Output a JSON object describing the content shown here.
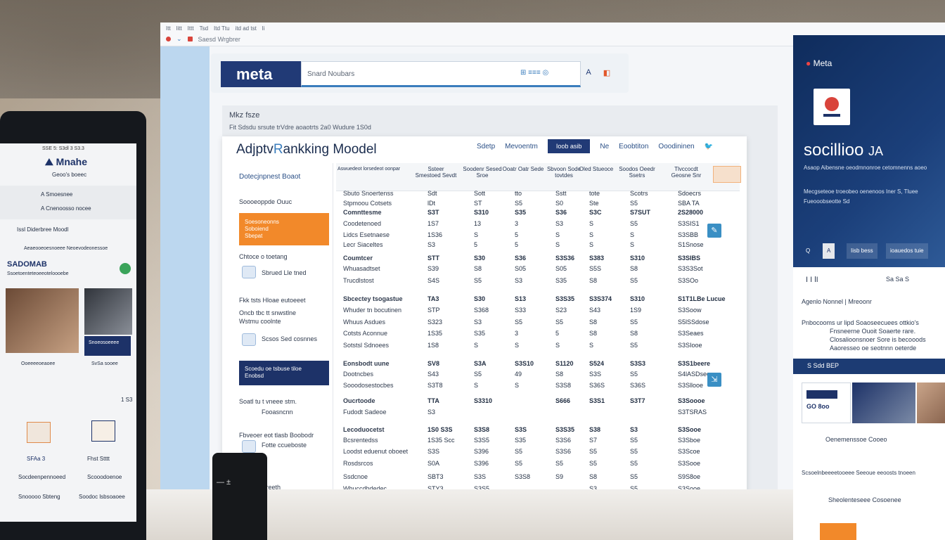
{
  "browser": {
    "tabs": [
      "Itt",
      "litt",
      "Ittt",
      "Tsd",
      "Itd Ttu",
      "itd ad tst",
      "li"
    ],
    "url": "Saesd Wrgbrer"
  },
  "header": {
    "logo": "meta",
    "search_placeholder": "Snard Noubars",
    "search_icons": "⊞ ≡≡≡ ◎",
    "btn_a": "A",
    "btn_b": "◧"
  },
  "page": {
    "crumb": "Mkz fsze",
    "subline": "Fit Sdsdu srsute trVdre aoaotrts 2a0 Wudure 1S0d"
  },
  "card": {
    "title_main": "Adjptv",
    "title_accent": "R",
    "title_rest": "ankking Moodel",
    "nav": [
      "Sdetp",
      "Mevoentm",
      "Ioob asib",
      "Ne",
      "Eoobtiton",
      "Ooodininen"
    ],
    "nav_active_index": 2
  },
  "side": {
    "heading": "Dotecjnpnest Boaot",
    "item1": "Soooeoppde Ouuc",
    "orange": [
      "Soesoneonns",
      "Soboiend",
      "Sbepat"
    ],
    "item2": "Chtoce o toetang",
    "item3": "Sbrued Lle tned",
    "item4": "Fkk tsts Hloae eutoeeet",
    "item5": "Oncb tbc tt snwstlne",
    "item6": "Wstmu coolnte",
    "item7": "Scsos Sed cosnnes",
    "navy": [
      "Scoedu oe tsbuse tiloe",
      "Enobsd"
    ],
    "item8": "Soatl tu t vneee stm.",
    "item9": "Fooasncnn",
    "item10": "Fbveoer eot tlasb Boobodr",
    "item11": "Fotte ccueboste",
    "item12": "Stuuuu ntreeth"
  },
  "table": {
    "headers": [
      "Aswuedeot lorsedeot oonpar",
      "Ssteer Smestoed Sevdt",
      "Soodenr Sesed Sroe",
      "Ooatr Oatr Sede",
      "Sbvoon Sode tovtdes",
      "Oled Stueoce",
      "Soodos Oeedr Ssetrs",
      "Tlvccocdt Geosne Snr"
    ],
    "rows": [
      {
        "label": "Sbuto Snoertenss",
        "cells": [
          "Sdt",
          "Sott",
          "tto",
          "Sstt",
          "tote",
          "Scotrs",
          "Sdoecrs"
        ],
        "style": ""
      },
      {
        "label": "Stpmoou Cotsets",
        "cells": [
          "lDt",
          "ST",
          "S5",
          "S0",
          "Ste",
          "S5",
          "SBA TA"
        ],
        "style": ""
      },
      {
        "label": "Comnttesme",
        "cells": [
          "S3T",
          "S310",
          "S35",
          "S36",
          "S3C",
          "S7SUT",
          "2S28000"
        ],
        "style": "group"
      },
      {
        "label": "Coodetenoed",
        "cells": [
          "1S7",
          "13",
          "3",
          "S3",
          "S",
          "S5",
          "S3SIS1"
        ],
        "style": ""
      },
      {
        "label": "Lidcs Esetnaese",
        "cells": [
          "1S36",
          "S",
          "5",
          "S",
          "S",
          "S",
          "S3SBB"
        ],
        "style": ""
      },
      {
        "label": "Lecr Siaceltes",
        "cells": [
          "S3",
          "5",
          "5",
          "S",
          "S",
          "S",
          "S1Snose"
        ],
        "style": ""
      },
      {
        "label": "Coumtcer",
        "cells": [
          "STT",
          "S30",
          "S36",
          "S3S36",
          "S383",
          "S310",
          "S3SIBS"
        ],
        "style": "group"
      },
      {
        "label": "Whuasadtset",
        "cells": [
          "S39",
          "S8",
          "S05",
          "S05",
          "S5S",
          "S8",
          "S3S3Sot"
        ],
        "style": ""
      },
      {
        "label": "Trucdlstost",
        "cells": [
          "S4S",
          "S5",
          "S3",
          "S35",
          "S8",
          "S5",
          "S3SOo"
        ],
        "style": ""
      },
      {
        "label": "Sbcectey tsogastue",
        "cells": [
          "TA3",
          "S30",
          "S13",
          "S3S35",
          "S3S374",
          "S310",
          "S1T1LBe Lucue"
        ],
        "style": "group"
      },
      {
        "label": "Whuder tn bocutinen",
        "cells": [
          "STP",
          "S368",
          "S33",
          "S23",
          "S43",
          "1S9",
          "S3Soow"
        ],
        "style": ""
      },
      {
        "label": "Whuus Asdues",
        "cells": [
          "S323",
          "S3",
          "S5",
          "S5",
          "S8",
          "S5",
          "S5lSSdose"
        ],
        "style": ""
      },
      {
        "label": "Cotsts Aconnue",
        "cells": [
          "1S35",
          "S35",
          "3",
          "5",
          "S8",
          "S8",
          "S3Seaes"
        ],
        "style": ""
      },
      {
        "label": "Sotstsl Sdnoees",
        "cells": [
          "1S8",
          "S",
          "S",
          "S",
          "S",
          "S5",
          "S3SIooe"
        ],
        "style": ""
      },
      {
        "label": "Eonsbodt uune",
        "cells": [
          "SV8",
          "S3A",
          "S3S10",
          "S1120",
          "S524",
          "S3S3",
          "S3S1beere"
        ],
        "style": "group"
      },
      {
        "label": "Dootncbes",
        "cells": [
          "S43",
          "S5",
          "49",
          "S8",
          "S3S",
          "S5",
          "S4lASDsee"
        ],
        "style": ""
      },
      {
        "label": "Sooodosestocbes",
        "cells": [
          "S3T8",
          "S",
          "S",
          "S3S8",
          "S36S",
          "S36S",
          "S3Sllooe"
        ],
        "style": ""
      },
      {
        "label": "Oucrtoode",
        "cells": [
          "TTA",
          "S3310",
          "",
          "S666",
          "S3S1",
          "S3T7",
          "S3Soooe"
        ],
        "style": "group"
      },
      {
        "label": "Fudodt Sadeoe",
        "cells": [
          "S3",
          "",
          "",
          "",
          "",
          "",
          "S3TSRAS"
        ],
        "style": ""
      },
      {
        "label": "Lecoduocetst",
        "cells": [
          "1S0 S3S",
          "S3S8",
          "S3S",
          "S3S35",
          "S38",
          "S3",
          "S3Sooe"
        ],
        "style": "group"
      },
      {
        "label": "Bcsrentedss",
        "cells": [
          "1S35 Scc",
          "S3S5",
          "S35",
          "S3S6",
          "S7",
          "S5",
          "S3Sboe"
        ],
        "style": ""
      },
      {
        "label": "Loodst eduenut oboeet",
        "cells": [
          "S3S",
          "S396",
          "S5",
          "S3S6",
          "S5",
          "S5",
          "S3Scoe"
        ],
        "style": ""
      },
      {
        "label": "Rosdsrcos",
        "cells": [
          "S0A",
          "S396",
          "S5",
          "S5",
          "S5",
          "S5",
          "S3Sooe"
        ],
        "style": ""
      },
      {
        "label": "Ssdcnoe",
        "cells": [
          "SBT3",
          "S3S",
          "S3S8",
          "S9",
          "S8",
          "S5",
          "S9S8oe"
        ],
        "style": ""
      },
      {
        "label": "Whuccdhdedec",
        "cells": [
          "STY3",
          "S3S5",
          "",
          "",
          "S3",
          "S5",
          "S3Sooe"
        ],
        "style": ""
      }
    ]
  },
  "right": {
    "brand": "Meta",
    "title": "socillioo",
    "title_accent": "JA",
    "sub1": "Asaop Aibensne oeodmnonroe cetomnenns aoeo",
    "sub2": "Mecgseteoe troeobeo oenenoos Iner S, Tluee",
    "sub3": "Fueooobseotte Sd",
    "chips": [
      "Q",
      "A",
      "Iisb bess",
      "ioauedos tuie"
    ],
    "row_a": "I I lI",
    "row_b": "Sa Sa S",
    "link_row": "Agenlo  Nonnel  |  Mreoonr",
    "item1": "Pnbocooms ur lipd Soaoseecuees ottkio's",
    "item2": "Fnsneerne Ouoit Soaerte rare.",
    "item3": "Closalioonsnoer Sore is becooods",
    "item4": "Aaoresseo oe seotnnn oeterde",
    "bar": "S Sdd BEP",
    "card1": "GO 8oo",
    "row_c": "Oenemenssoe Cooeo",
    "row_d": "Scsoelnbeeeetooeee Seeoue eeoosts tnoeen",
    "row_e": "Sheolenteseee Cosoenee"
  },
  "tablet": {
    "status": "SSE 5: S3dl 3 S3.3",
    "app": "Mnahe",
    "app_sub": "Geoo's boeec",
    "nav1": "A  Smoesnee",
    "nav2": "A  Cnenoosso nocee",
    "tabline": "Issl  Diderbree Moodl",
    "headline": "SADOMAB",
    "desc1": "Aeaeooeoesnoeee Neoevodeonessoe",
    "desc2": "Ssoetoenteteoeeoteloooebe",
    "badge": "Snoeosoeeee",
    "cap1": "Ooeeeeoeaoee",
    "cap2": "SvSa sooee",
    "count": "1 S3",
    "p1_a": "SFAa 3",
    "p2_a": "Fhst Stttt",
    "p3_a": "Socdeenpennoeed",
    "p4_a": "Scooodoenoe",
    "p5_a": "Snooooo Sbteng",
    "p6_a": "Soodoc lsbsoaoee"
  },
  "device": {
    "label": "— ±"
  }
}
